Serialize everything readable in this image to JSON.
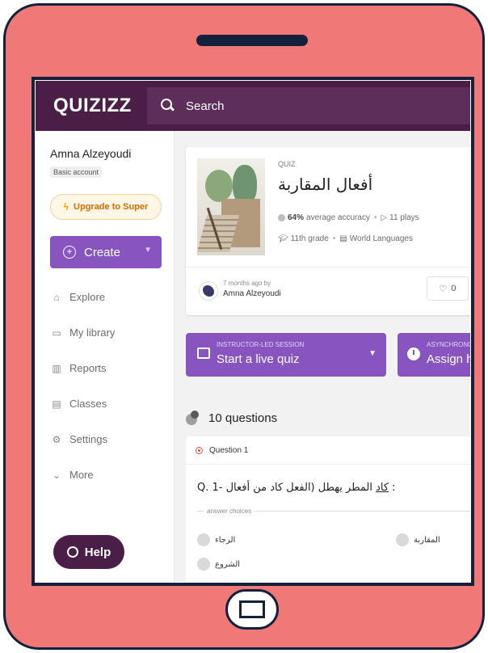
{
  "app": {
    "logo": "QUIZIZZ"
  },
  "search": {
    "label": "Search"
  },
  "sidebar": {
    "user_name": "Amna Alzeyoudi",
    "account_type": "Basic account",
    "upgrade_label": "Upgrade to Super",
    "create_label": "Create",
    "items": [
      {
        "label": "Explore",
        "icon": "explore-icon"
      },
      {
        "label": "My library",
        "icon": "folder-icon"
      },
      {
        "label": "Reports",
        "icon": "reports-icon"
      },
      {
        "label": "Classes",
        "icon": "classes-icon"
      },
      {
        "label": "Settings",
        "icon": "gear-icon"
      },
      {
        "label": "More",
        "icon": "chevron-down-icon"
      }
    ],
    "help_label": "Help"
  },
  "quiz": {
    "type": "QUIZ",
    "title": "أفعال المقاربة",
    "accuracy": "64%",
    "accuracy_text": "average accuracy",
    "plays": "11 plays",
    "grade": "11th grade",
    "subject": "World Languages",
    "created_ago": "7 months ago by",
    "author": "Amna Alzeyoudi",
    "likes": "0"
  },
  "actions": {
    "live_small": "INSTRUCTOR-LED SESSION",
    "live_label": "Start a live quiz",
    "async_small": "ASYNCHRONOUS",
    "async_label": "Assign homework"
  },
  "questions": {
    "count_label": "10 questions",
    "q1_label": "Question 1",
    "q1_prefix": "Q. 1- ",
    "q1_text_a": "كاد",
    "q1_text_b": " المطر يهطل (الفعل كاد من أفعال :",
    "answer_choices_label": "answer choices",
    "choices": [
      "الرجاء",
      "المقاربة",
      "الشروع"
    ]
  },
  "colors": {
    "frame": "#f07876",
    "frame_border": "#14213d",
    "topbar": "#4a1e47",
    "accent_purple": "#8854c0"
  }
}
